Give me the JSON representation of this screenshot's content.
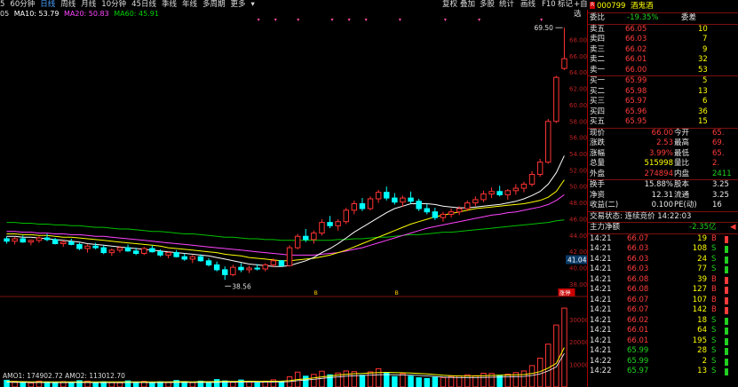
{
  "toolbar": {
    "left_items": [
      "5",
      "60分钟",
      "日线",
      "周线",
      "月线",
      "10分钟",
      "45日线",
      "季线",
      "年线",
      "多周期",
      "更多"
    ],
    "active_index": 2,
    "right_items": [
      "复权",
      "叠加",
      "多股",
      "统计",
      "画线",
      "F10",
      "标记",
      "+自选",
      "返回"
    ]
  },
  "ma_line": {
    "prefix": "05",
    "ma10": "MA10: 53.79",
    "ma20": "MA20: 50.83",
    "ma60": "MA60: 45.91"
  },
  "colors": {
    "ma10": "#ffffff",
    "ma20": "#ffff00",
    "ma30": "#ff44ff",
    "ma60": "#00c000",
    "up": "#ff3333",
    "down": "#00ffff"
  },
  "chart_data": {
    "type": "candlestick",
    "y_axis_ticks": [
      "68.00",
      "66.00",
      "64.00",
      "62.00",
      "60.00",
      "58.00",
      "56.00",
      "54.00",
      "52.00",
      "50.00",
      "48.00",
      "46.00",
      "44.00",
      "42.00",
      "40.00",
      "38.00"
    ],
    "ylim": [
      37.5,
      70.5
    ],
    "max_label": "69.50",
    "min_label": "38.56",
    "current_price_tag": "41.04",
    "signal_labels": [
      "B",
      "B",
      "涨停"
    ],
    "ohlc": [
      [
        43.6,
        43.9,
        43.0,
        43.3
      ],
      [
        43.3,
        43.8,
        42.9,
        43.6
      ],
      [
        43.6,
        44.0,
        43.1,
        43.2
      ],
      [
        43.2,
        43.5,
        42.8,
        43.4
      ],
      [
        43.4,
        43.9,
        43.1,
        43.7
      ],
      [
        43.7,
        44.2,
        43.3,
        43.5
      ],
      [
        43.5,
        43.7,
        42.9,
        43.0
      ],
      [
        43.0,
        43.4,
        42.6,
        43.2
      ],
      [
        43.2,
        43.6,
        42.8,
        42.9
      ],
      [
        42.9,
        43.1,
        42.2,
        42.4
      ],
      [
        42.4,
        42.9,
        41.9,
        42.7
      ],
      [
        42.7,
        43.1,
        42.3,
        42.5
      ],
      [
        42.5,
        42.8,
        41.7,
        41.9
      ],
      [
        41.9,
        42.4,
        41.5,
        42.2
      ],
      [
        42.2,
        42.7,
        41.9,
        42.5
      ],
      [
        42.5,
        42.9,
        42.0,
        42.1
      ],
      [
        42.1,
        42.5,
        41.6,
        41.8
      ],
      [
        41.8,
        42.6,
        41.6,
        42.4
      ],
      [
        42.4,
        42.8,
        41.9,
        42.0
      ],
      [
        42.0,
        42.3,
        41.4,
        41.6
      ],
      [
        41.6,
        42.0,
        41.2,
        41.9
      ],
      [
        41.9,
        42.2,
        41.3,
        41.4
      ],
      [
        41.4,
        41.8,
        40.9,
        41.1
      ],
      [
        41.1,
        41.6,
        40.6,
        41.4
      ],
      [
        41.4,
        41.7,
        40.8,
        40.9
      ],
      [
        40.9,
        41.2,
        40.2,
        40.4
      ],
      [
        40.4,
        40.8,
        39.6,
        39.8
      ],
      [
        39.8,
        40.2,
        38.56,
        39.2
      ],
      [
        39.2,
        40.4,
        39.0,
        40.1
      ],
      [
        40.1,
        40.6,
        39.5,
        39.8
      ],
      [
        39.8,
        40.3,
        39.4,
        40.0
      ],
      [
        40.0,
        40.5,
        39.7,
        39.9
      ],
      [
        39.9,
        40.6,
        39.6,
        40.4
      ],
      [
        40.4,
        41.2,
        40.1,
        40.9
      ],
      [
        40.9,
        41.0,
        40.2,
        40.3
      ],
      [
        40.3,
        42.8,
        40.2,
        42.5
      ],
      [
        42.5,
        44.2,
        42.3,
        43.9
      ],
      [
        43.9,
        44.8,
        43.2,
        43.5
      ],
      [
        43.5,
        44.6,
        43.0,
        44.3
      ],
      [
        44.3,
        46.0,
        44.0,
        45.6
      ],
      [
        45.6,
        46.4,
        44.9,
        45.2
      ],
      [
        45.2,
        46.0,
        44.6,
        45.7
      ],
      [
        45.7,
        47.4,
        45.4,
        47.1
      ],
      [
        47.1,
        48.3,
        46.6,
        47.9
      ],
      [
        47.9,
        48.6,
        47.0,
        47.3
      ],
      [
        47.3,
        48.8,
        47.1,
        48.5
      ],
      [
        48.5,
        49.6,
        48.0,
        49.3
      ],
      [
        49.3,
        50.0,
        48.3,
        48.6
      ],
      [
        48.6,
        49.2,
        47.8,
        48.1
      ],
      [
        48.1,
        48.9,
        47.5,
        48.6
      ],
      [
        48.6,
        49.4,
        47.9,
        48.2
      ],
      [
        48.2,
        48.5,
        47.0,
        47.3
      ],
      [
        47.3,
        47.9,
        46.6,
        46.9
      ],
      [
        46.9,
        47.4,
        45.9,
        46.2
      ],
      [
        46.2,
        46.9,
        45.7,
        46.6
      ],
      [
        46.6,
        47.3,
        46.2,
        46.9
      ],
      [
        46.9,
        47.6,
        46.5,
        47.3
      ],
      [
        47.3,
        48.3,
        47.0,
        48.0
      ],
      [
        48.0,
        48.8,
        47.6,
        48.4
      ],
      [
        48.4,
        49.5,
        48.1,
        49.1
      ],
      [
        49.1,
        49.9,
        48.6,
        49.4
      ],
      [
        49.4,
        50.1,
        48.8,
        49.0
      ],
      [
        49.0,
        49.7,
        48.4,
        49.5
      ],
      [
        49.5,
        50.3,
        49.0,
        49.8
      ],
      [
        49.8,
        50.6,
        49.3,
        50.3
      ],
      [
        50.3,
        51.9,
        50.0,
        51.5
      ],
      [
        51.5,
        53.4,
        51.2,
        53.0
      ],
      [
        53.0,
        58.3,
        52.8,
        58.0
      ],
      [
        58.0,
        63.6,
        57.8,
        63.4
      ],
      [
        64.5,
        69.5,
        64.3,
        65.7
      ]
    ],
    "ma10": [
      43.9,
      43.9,
      43.8,
      43.8,
      43.7,
      43.6,
      43.5,
      43.4,
      43.3,
      43.2,
      43.0,
      42.9,
      42.8,
      42.7,
      42.6,
      42.5,
      42.4,
      42.3,
      42.2,
      42.1,
      42.0,
      41.9,
      41.8,
      41.7,
      41.6,
      41.5,
      41.3,
      41.1,
      40.9,
      40.7,
      40.5,
      40.4,
      40.3,
      40.2,
      40.2,
      40.3,
      40.6,
      40.9,
      41.3,
      41.9,
      42.4,
      43.0,
      43.7,
      44.4,
      45.0,
      45.6,
      46.2,
      46.8,
      47.3,
      47.6,
      47.9,
      47.9,
      47.9,
      47.8,
      47.6,
      47.5,
      47.4,
      47.4,
      47.5,
      47.6,
      47.7,
      47.8,
      48.0,
      48.2,
      48.5,
      48.9,
      49.4,
      50.3,
      51.7,
      53.79
    ],
    "ma20": [
      44.2,
      44.2,
      44.1,
      44.1,
      44.0,
      44.0,
      43.9,
      43.8,
      43.8,
      43.7,
      43.6,
      43.5,
      43.4,
      43.3,
      43.2,
      43.1,
      43.0,
      42.9,
      42.8,
      42.7,
      42.5,
      42.4,
      42.3,
      42.2,
      42.1,
      42.0,
      41.9,
      41.7,
      41.6,
      41.5,
      41.3,
      41.2,
      41.1,
      41.0,
      40.9,
      40.9,
      41.0,
      41.1,
      41.2,
      41.4,
      41.6,
      41.9,
      42.2,
      42.6,
      43.0,
      43.4,
      43.8,
      44.2,
      44.6,
      45.0,
      45.4,
      45.7,
      46.0,
      46.3,
      46.5,
      46.7,
      46.9,
      47.1,
      47.3,
      47.4,
      47.5,
      47.6,
      47.7,
      47.8,
      47.9,
      48.1,
      48.3,
      48.7,
      49.4,
      50.83
    ],
    "ma30": [
      44.5,
      44.5,
      44.4,
      44.4,
      44.3,
      44.3,
      44.2,
      44.2,
      44.1,
      44.1,
      44.0,
      43.9,
      43.9,
      43.8,
      43.7,
      43.6,
      43.5,
      43.4,
      43.3,
      43.2,
      43.1,
      43.0,
      42.9,
      42.8,
      42.7,
      42.6,
      42.5,
      42.4,
      42.3,
      42.2,
      42.1,
      42.0,
      41.9,
      41.8,
      41.7,
      41.6,
      41.6,
      41.6,
      41.6,
      41.7,
      41.8,
      41.9,
      42.1,
      42.3,
      42.5,
      42.8,
      43.1,
      43.4,
      43.7,
      44.0,
      44.3,
      44.6,
      44.9,
      45.1,
      45.3,
      45.5,
      45.7,
      45.9,
      46.1,
      46.3,
      46.5,
      46.6,
      46.8,
      46.9,
      47.1,
      47.3,
      47.5,
      47.8,
      48.3,
      49.0
    ],
    "ma60": [
      45.6,
      45.6,
      45.5,
      45.5,
      45.4,
      45.4,
      45.3,
      45.3,
      45.2,
      45.2,
      45.1,
      45.0,
      45.0,
      44.9,
      44.8,
      44.8,
      44.7,
      44.6,
      44.5,
      44.5,
      44.4,
      44.3,
      44.2,
      44.2,
      44.1,
      44.0,
      43.9,
      43.8,
      43.8,
      43.7,
      43.6,
      43.6,
      43.5,
      43.5,
      43.4,
      43.4,
      43.4,
      43.4,
      43.4,
      43.4,
      43.4,
      43.5,
      43.5,
      43.6,
      43.6,
      43.7,
      43.8,
      43.8,
      43.9,
      44.0,
      44.1,
      44.1,
      44.2,
      44.3,
      44.4,
      44.4,
      44.5,
      44.6,
      44.7,
      44.8,
      44.9,
      45.0,
      45.1,
      45.2,
      45.3,
      45.4,
      45.5,
      45.6,
      45.8,
      45.91
    ],
    "volume_label": "AMO1: 174902.72  AMO2: 113012.70",
    "volume_ticks": [
      "30000",
      "20000",
      "10000"
    ],
    "volume": [
      3000,
      2500,
      2000,
      1800,
      2600,
      2200,
      1900,
      2400,
      2000,
      2800,
      2600,
      1700,
      2300,
      2100,
      1900,
      2700,
      2200,
      2500,
      1800,
      2300,
      2000,
      2900,
      2400,
      2100,
      2600,
      1900,
      3300,
      2700,
      2200,
      3100,
      2400,
      2000,
      2600,
      3200,
      2500,
      4500,
      6600,
      4800,
      5600,
      7000,
      5400,
      6200,
      7100,
      6800,
      5200,
      6700,
      8100,
      6400,
      4600,
      5900,
      4800,
      4100,
      3800,
      4300,
      4200,
      4700,
      4900,
      5400,
      5000,
      6100,
      6000,
      5200,
      5700,
      6400,
      7100,
      9500,
      12800,
      19000,
      27500,
      35000
    ],
    "amo1": [
      2500,
      2400,
      2350,
      2300,
      2300,
      2300,
      2250,
      2250,
      2300,
      2300,
      2300,
      2250,
      2250,
      2250,
      2250,
      2300,
      2300,
      2300,
      2250,
      2300,
      2300,
      2350,
      2350,
      2300,
      2350,
      2350,
      2400,
      2500,
      2450,
      2500,
      2550,
      2500,
      2500,
      2550,
      2600,
      2800,
      3300,
      3600,
      4000,
      4500,
      4900,
      5300,
      5600,
      5900,
      6000,
      6200,
      6400,
      6500,
      6400,
      6300,
      6200,
      6000,
      5800,
      5500,
      5200,
      5000,
      4900,
      4800,
      4900,
      5000,
      5100,
      5200,
      5300,
      5400,
      5500,
      6000,
      6800,
      8400,
      10500,
      17490
    ]
  },
  "stock": {
    "marker": "R",
    "code": "000799",
    "name": "酒鬼酒"
  },
  "weibi": {
    "label": "委比",
    "value": "-19.35%",
    "label2": "委差"
  },
  "sells": [
    {
      "name": "卖五",
      "price": "66.05",
      "vol": "10"
    },
    {
      "name": "卖四",
      "price": "66.03",
      "vol": "7"
    },
    {
      "name": "卖三",
      "price": "66.02",
      "vol": "9"
    },
    {
      "name": "卖二",
      "price": "66.01",
      "vol": "32"
    },
    {
      "name": "卖一",
      "price": "66.00",
      "vol": "53"
    }
  ],
  "buys": [
    {
      "name": "买一",
      "price": "65.99",
      "vol": "5"
    },
    {
      "name": "买二",
      "price": "65.98",
      "vol": "13"
    },
    {
      "name": "买三",
      "price": "65.97",
      "vol": "6"
    },
    {
      "name": "买四",
      "price": "65.96",
      "vol": "36"
    },
    {
      "name": "买五",
      "price": "65.95",
      "vol": "15"
    }
  ],
  "quote": [
    {
      "l1": "现价",
      "v1": "66.00",
      "c1": "red",
      "l2": "今开",
      "v2": "65.",
      "c2": "red"
    },
    {
      "l1": "涨跌",
      "v1": "2.53",
      "c1": "red",
      "l2": "最高",
      "v2": "69.",
      "c2": "red"
    },
    {
      "l1": "涨幅",
      "v1": "3.99%",
      "c1": "red",
      "l2": "最低",
      "v2": "65.",
      "c2": "red"
    },
    {
      "l1": "总量",
      "v1": "515998",
      "c1": "yellow",
      "l2": "量比",
      "v2": "2.",
      "c2": "red"
    },
    {
      "l1": "外盘",
      "v1": "274894",
      "c1": "red",
      "l2": "内盘",
      "v2": "2411",
      "c2": "green"
    },
    {
      "l1": "换手",
      "v1": "15.88%",
      "c1": "white",
      "l2": "股本",
      "v2": "3.25",
      "c2": "white"
    },
    {
      "l1": "净资",
      "v1": "12.31",
      "c1": "white",
      "l2": "流通",
      "v2": "3.25",
      "c2": "white"
    },
    {
      "l1": "收益(二)",
      "v1": "0.100",
      "c1": "white",
      "l2": "PE(动)",
      "v2": "16",
      "c2": "white"
    }
  ],
  "trade_status": {
    "label": "交易状态: 连续竞价 14:22:03"
  },
  "main_flow": {
    "label": "主力净额",
    "value": "-2.35亿",
    "arrow": "◀"
  },
  "ticks": [
    {
      "t": "14:21",
      "p": "66.07",
      "v": "19",
      "d": "B"
    },
    {
      "t": "14:21",
      "p": "66.03",
      "v": "108",
      "d": "S"
    },
    {
      "t": "14:21",
      "p": "66.03",
      "v": "24",
      "d": "S"
    },
    {
      "t": "14:21",
      "p": "66.03",
      "v": "77",
      "d": "S"
    },
    {
      "t": "14:21",
      "p": "66.08",
      "v": "39",
      "d": "B"
    },
    {
      "t": "14:21",
      "p": "66.08",
      "v": "127",
      "d": "B"
    },
    {
      "t": "14:21",
      "p": "66.07",
      "v": "107",
      "d": "B"
    },
    {
      "t": "14:21",
      "p": "66.07",
      "v": "142",
      "d": "B"
    },
    {
      "t": "14:21",
      "p": "66.02",
      "v": "18",
      "d": "S"
    },
    {
      "t": "14:21",
      "p": "66.01",
      "v": "64",
      "d": "S"
    },
    {
      "t": "14:21",
      "p": "66.01",
      "v": "195",
      "d": "S"
    },
    {
      "t": "14:21",
      "p": "65.99",
      "v": "28",
      "d": "S"
    },
    {
      "t": "14:22",
      "p": "65.99",
      "v": "2",
      "d": "S"
    },
    {
      "t": "14:22",
      "p": "65.97",
      "v": "13",
      "d": "S"
    }
  ]
}
